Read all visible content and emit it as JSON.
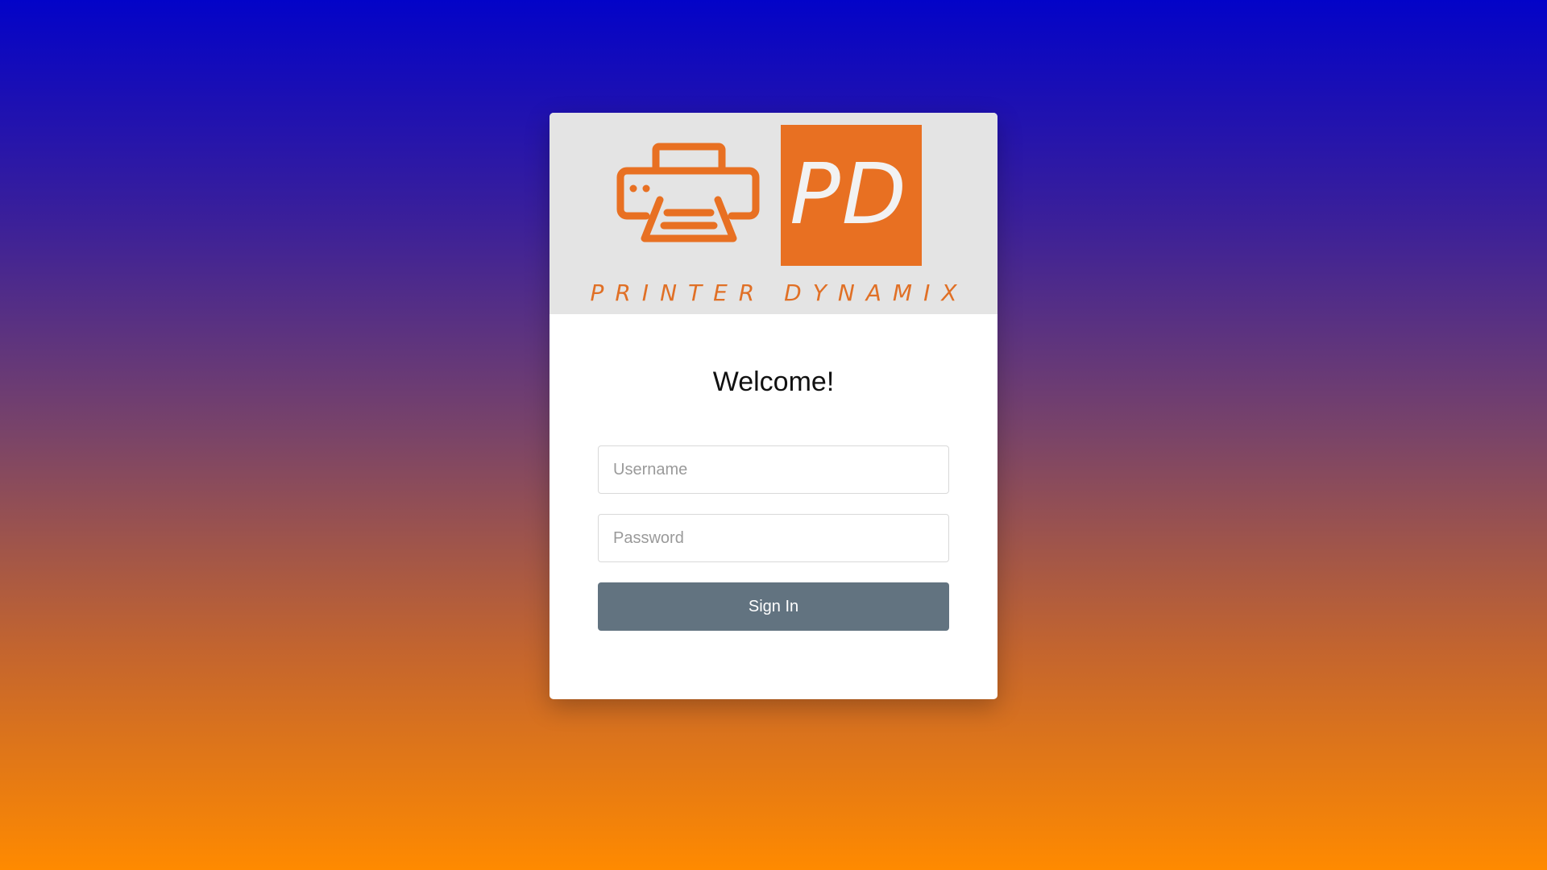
{
  "page": {
    "background_top_color": "#0303c8",
    "background_bottom_color": "#ff8a00"
  },
  "logo": {
    "monogram": "PD",
    "brand_name": "PRINTER DYNAMIX",
    "icon": "printer-icon",
    "accent_color": "#e87022",
    "banner_color": "#e4e4e4"
  },
  "login": {
    "heading": "Welcome!",
    "username_placeholder": "Username",
    "username_value": "",
    "password_placeholder": "Password",
    "password_value": "",
    "sign_in_label": "Sign In",
    "button_color": "#627380"
  }
}
